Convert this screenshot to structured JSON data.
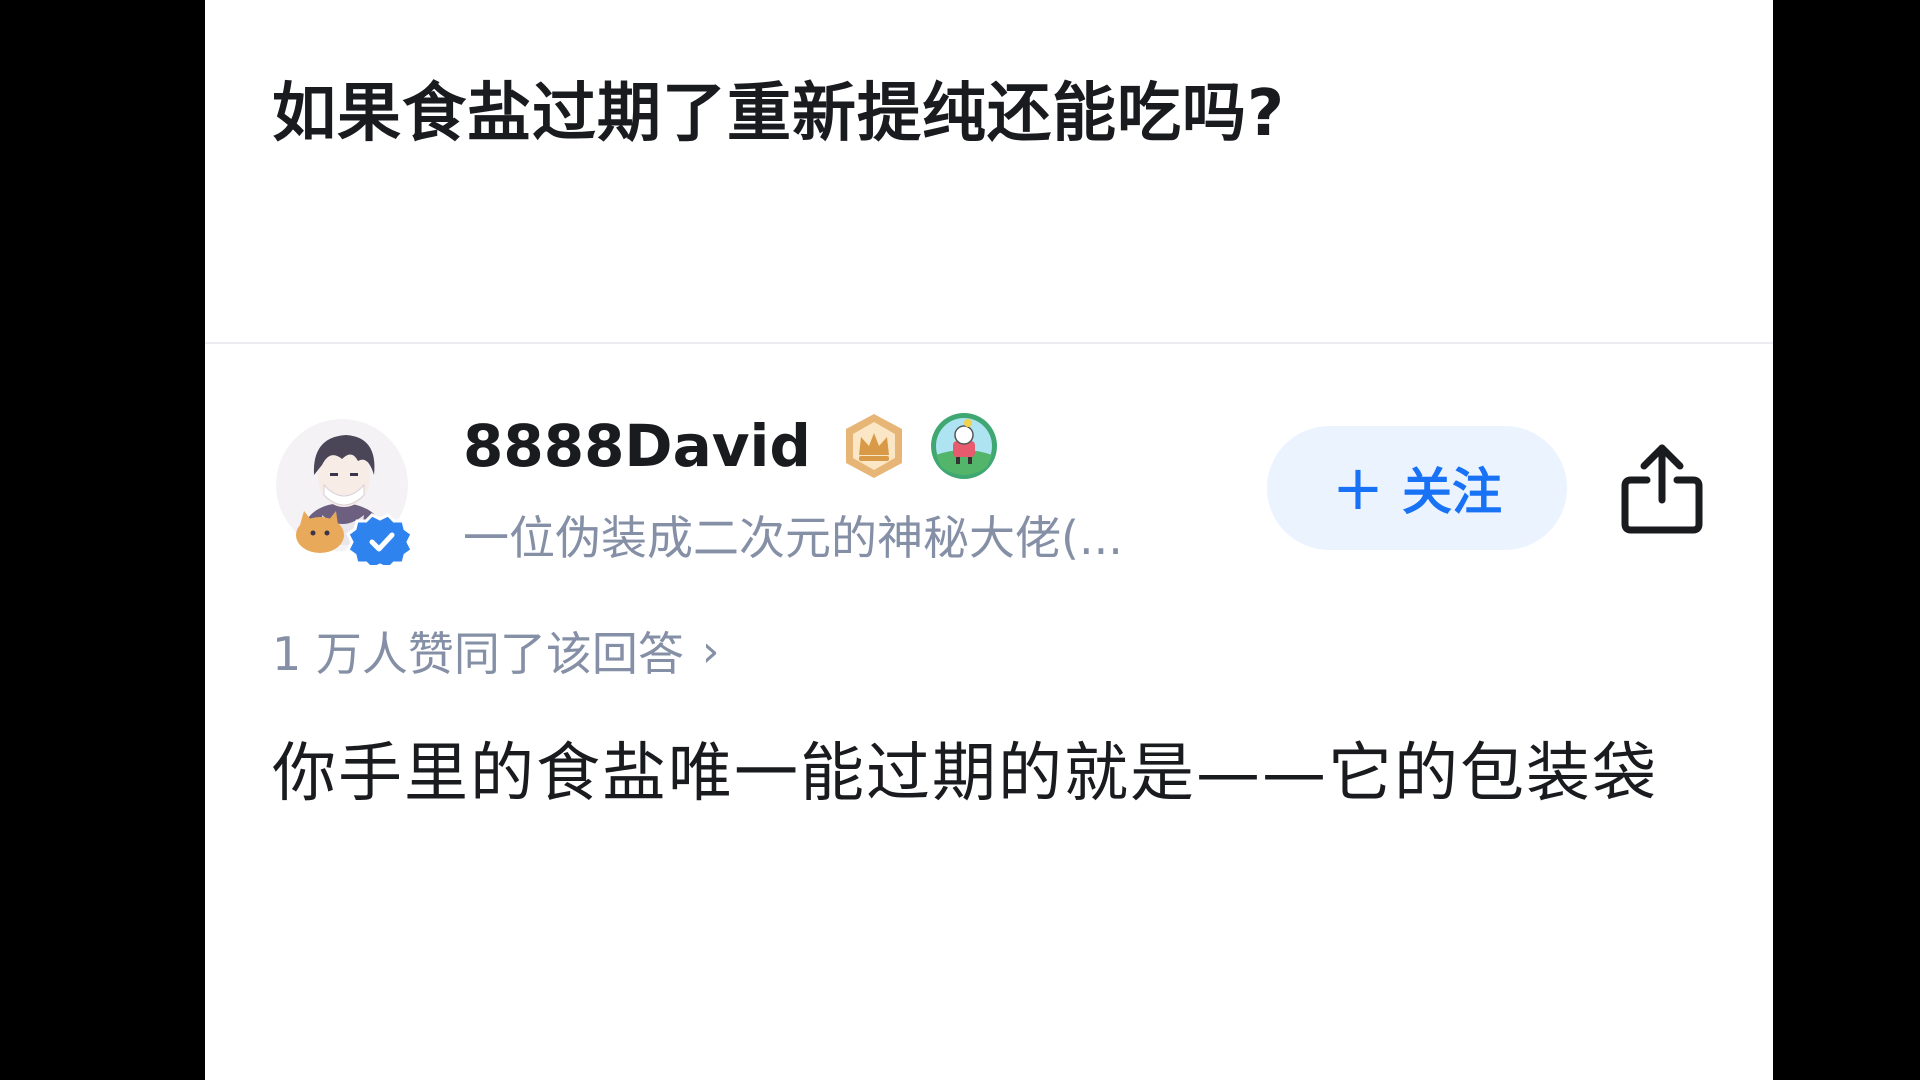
{
  "question": {
    "title": "如果食盐过期了重新提纯还能吃吗?"
  },
  "author": {
    "name": "8888David",
    "bio": "一位伪装成二次元的神秘大佬(...",
    "avatar_icon": "anime-avatar-icon",
    "verified_icon": "verified-check-icon",
    "badges": [
      "crown-badge-icon",
      "achievement-badge-icon"
    ],
    "accent_color": "#1772f6"
  },
  "actions": {
    "follow_plus": "+",
    "follow_label": "关注",
    "share_icon": "share-icon"
  },
  "answer": {
    "vote_summary": "1 万人赞同了该回答",
    "vote_chevron": "›",
    "content": "你手里的食盐唯一能过期的就是——它的包装袋"
  }
}
